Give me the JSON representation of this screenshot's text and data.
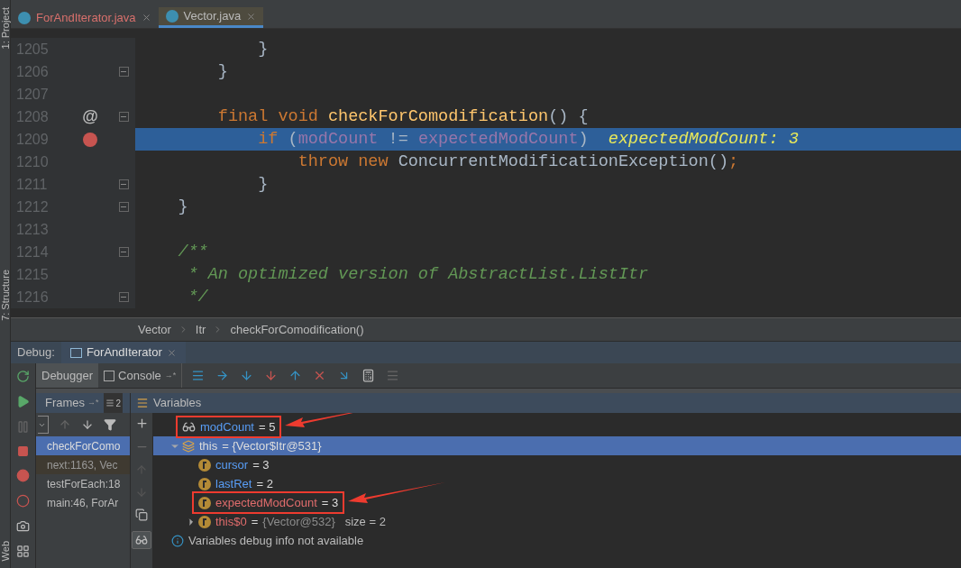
{
  "side_tabs": [
    {
      "label": "1: Project"
    },
    {
      "label": "7: Structure"
    },
    {
      "label": "Web"
    }
  ],
  "editor_tabs": [
    {
      "label": "ForAndIterator.java",
      "selected": false,
      "problem": true
    },
    {
      "label": "Vector.java",
      "selected": true,
      "problem": false
    }
  ],
  "code_lines": [
    {
      "number": "1205",
      "highlighted": false,
      "tokens": [
        {
          "kind": "plain",
          "text": "            }"
        }
      ]
    },
    {
      "number": "1206",
      "fold": true,
      "highlighted": false,
      "tokens": [
        {
          "kind": "plain",
          "text": "        }"
        }
      ]
    },
    {
      "number": "1207",
      "highlighted": false
    },
    {
      "number": "1208",
      "fold": true,
      "highlighted": false,
      "gutter_mark": "@",
      "tokens": [
        {
          "kind": "keyword",
          "text": "        final void "
        },
        {
          "kind": "method",
          "text": "checkForComodification"
        },
        {
          "kind": "plain",
          "text": "() {"
        }
      ]
    },
    {
      "number": "1209",
      "highlighted": true,
      "breakpoint": true,
      "tokens": [
        {
          "kind": "keyword",
          "text": "            if "
        },
        {
          "kind": "plain",
          "text": "("
        },
        {
          "kind": "field",
          "text": "modCount"
        },
        {
          "kind": "plain",
          "text": " != "
        },
        {
          "kind": "field",
          "text": "expectedModCount"
        },
        {
          "kind": "plain",
          "text": ")  "
        },
        {
          "kind": "hint",
          "text": "expectedModCount: 3"
        }
      ]
    },
    {
      "number": "1210",
      "highlighted": false,
      "tokens": [
        {
          "kind": "keyword",
          "text": "                throw new "
        },
        {
          "kind": "plain",
          "text": "ConcurrentModificationException()"
        },
        {
          "kind": "keyword",
          "text": ";"
        }
      ]
    },
    {
      "number": "1211",
      "fold": true,
      "highlighted": false,
      "tokens": [
        {
          "kind": "plain",
          "text": "            }"
        }
      ]
    },
    {
      "number": "1212",
      "fold": true,
      "highlighted": false,
      "tokens": [
        {
          "kind": "plain",
          "text": "    }"
        }
      ]
    },
    {
      "number": "1213",
      "highlighted": false
    },
    {
      "number": "1214",
      "fold": true,
      "highlighted": false,
      "tokens": [
        {
          "kind": "comment",
          "text": "    /**"
        }
      ]
    },
    {
      "number": "1215",
      "highlighted": false,
      "tokens": [
        {
          "kind": "comment",
          "text": "     * An optimized version of AbstractList.ListItr"
        }
      ]
    },
    {
      "number": "1216",
      "fold": true,
      "highlighted": false,
      "tokens": [
        {
          "kind": "comment",
          "text": "     */"
        }
      ]
    }
  ],
  "breadcrumbs": [
    "Vector",
    "Itr",
    "checkForComodification()"
  ],
  "debug_bar": {
    "label": "Debug:",
    "session": "ForAndIterator"
  },
  "debug_tabs": [
    {
      "label": "Debugger",
      "selected": true,
      "kind": "plain"
    },
    {
      "label": "Console",
      "selected": false,
      "kind": "console",
      "pin": "→*"
    }
  ],
  "frames_header": {
    "label": "Frames",
    "pin": "→*",
    "threads": "2"
  },
  "variables_header": {
    "label": "Variables"
  },
  "frames": [
    {
      "label": "checkForComo",
      "selected": true
    },
    {
      "label": "next:1163, Vec",
      "selected": false,
      "library": true
    },
    {
      "label": "testForEach:18",
      "selected": false
    },
    {
      "label": "main:46, ForAr",
      "selected": false
    }
  ],
  "variables": [
    {
      "kind": "watch",
      "name": "modCount",
      "value": "= 5",
      "selected": false,
      "annotated": true
    },
    {
      "kind": "object",
      "name": "this",
      "value": "= {Vector$Itr@531}",
      "selected": true,
      "expanded": true,
      "children": [
        {
          "kind": "field",
          "name": "cursor",
          "value": "= 3",
          "changed": false
        },
        {
          "kind": "field",
          "name": "lastRet",
          "value": "= 2",
          "changed": false
        },
        {
          "kind": "field",
          "name": "expectedModCount",
          "value": "= 3",
          "changed": true,
          "annotated": true
        },
        {
          "kind": "field",
          "name": "this$0",
          "value": "=",
          "ref": "{Vector@532}",
          "extra": "size = 2",
          "changed": true,
          "expanded": false
        }
      ]
    },
    {
      "kind": "info",
      "text": "Variables debug info not available"
    }
  ]
}
